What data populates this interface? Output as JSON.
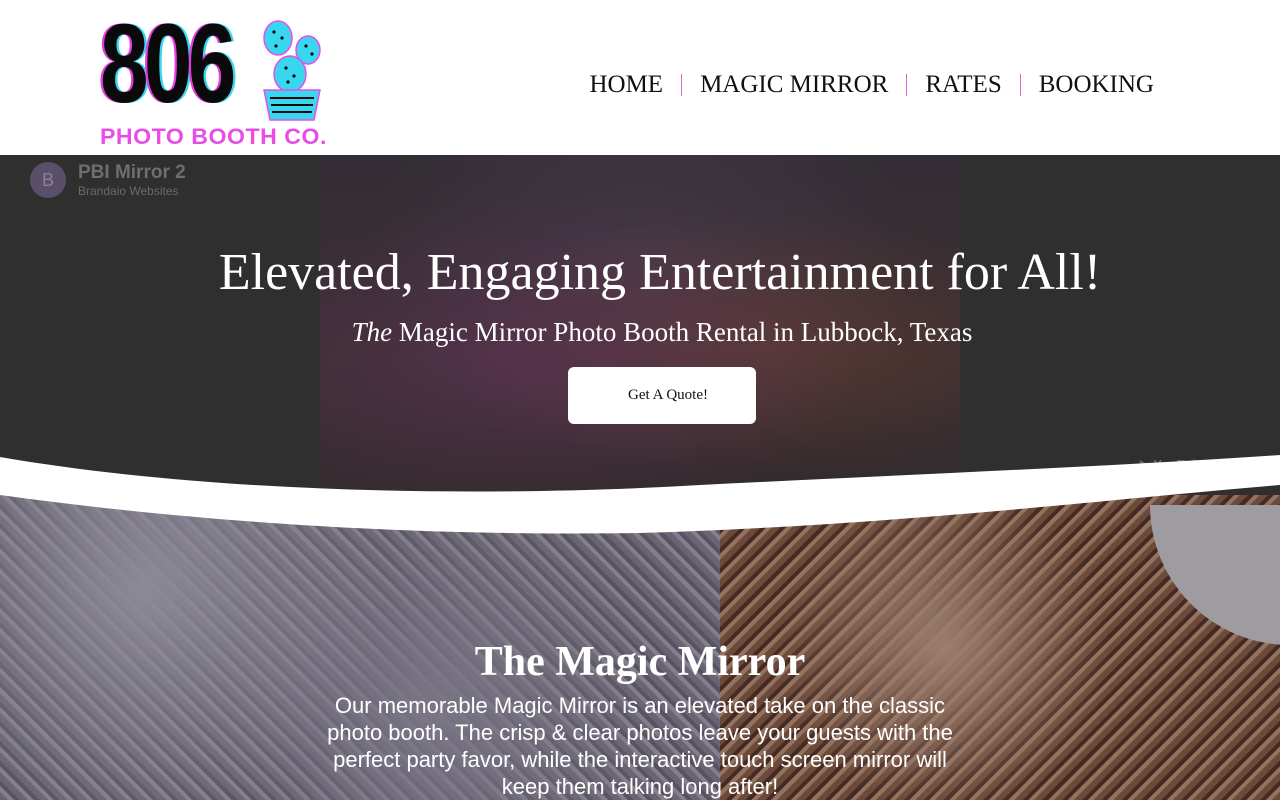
{
  "logo": {
    "digits": "806",
    "tagline": "PHOTO BOOTH CO.",
    "colors": {
      "black": "#0a0a0a",
      "pink": "#e84ee6",
      "cyan": "#39d6f0"
    }
  },
  "nav": {
    "items": [
      {
        "label": "HOME"
      },
      {
        "label": "MAGIC MIRROR"
      },
      {
        "label": "RATES"
      },
      {
        "label": "BOOKING"
      }
    ],
    "separator_color": "#d86bd6"
  },
  "video": {
    "title": "PBI Mirror 2",
    "channel": "Brandaio Websites",
    "avatar_letter": "B",
    "platform": "YouTube"
  },
  "hero": {
    "heading": "Elevated, Engaging Entertainment for All!",
    "sub_em": "The",
    "sub_rest": " Magic Mirror Photo Booth Rental in Lubbock, Texas",
    "cta_icon": "",
    "cta_label": "Get A Quote!"
  },
  "mirror_section": {
    "heading": "The Magic Mirror",
    "body": "Our memorable Magic Mirror is an elevated take on the classic photo booth. The crisp & clear photos leave your guests with the perfect party favor, while the interactive touch screen mirror will keep them talking long after!"
  }
}
